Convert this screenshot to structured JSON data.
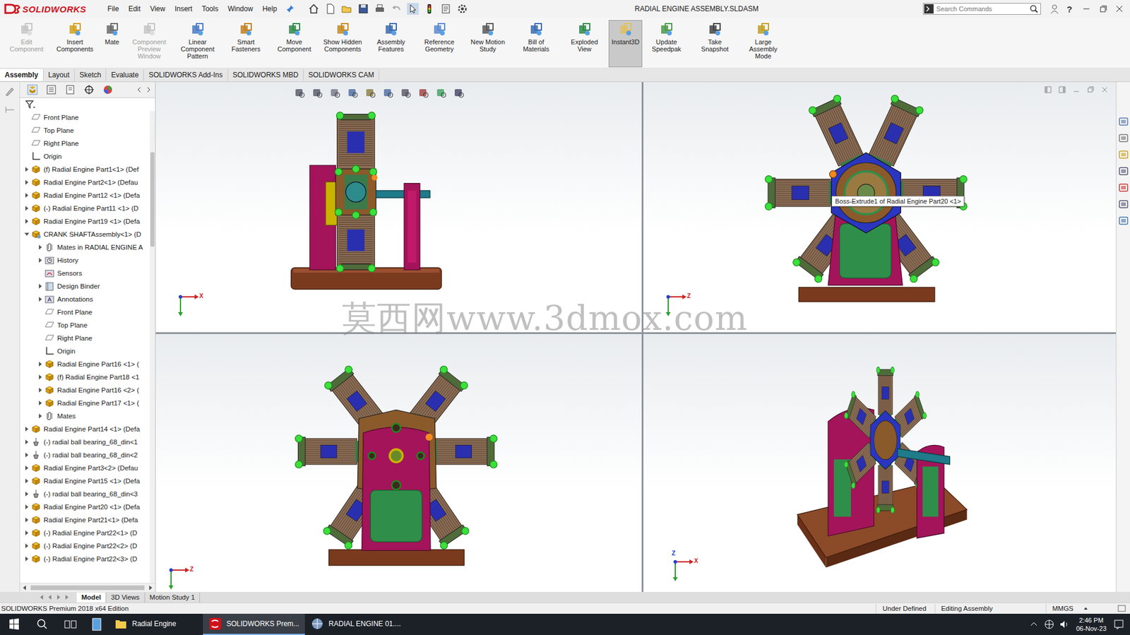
{
  "app": {
    "logo": "SOLIDWORKS"
  },
  "menu": [
    "File",
    "Edit",
    "View",
    "Insert",
    "Tools",
    "Window",
    "Help"
  ],
  "window": {
    "title": "RADIAL ENGINE ASSEMBLY.SLDASM"
  },
  "search": {
    "placeholder": "Search Commands"
  },
  "help": "?",
  "ribbon": [
    {
      "label": "Edit Component",
      "disabled": true,
      "selected": false
    },
    {
      "label": "Insert Components",
      "disabled": false,
      "selected": false
    },
    {
      "label": "Mate",
      "disabled": false,
      "selected": false
    },
    {
      "label": "Component Preview Window",
      "disabled": true,
      "selected": false
    },
    {
      "label": "Linear Component Pattern",
      "disabled": false,
      "selected": false
    },
    {
      "label": "Smart Fasteners",
      "disabled": false,
      "selected": false
    },
    {
      "label": "Move Component",
      "disabled": false,
      "selected": false
    },
    {
      "label": "Show Hidden Components",
      "disabled": false,
      "selected": false
    },
    {
      "label": "Assembly Features",
      "disabled": false,
      "selected": false
    },
    {
      "label": "Reference Geometry",
      "disabled": false,
      "selected": false
    },
    {
      "label": "New Motion Study",
      "disabled": false,
      "selected": false
    },
    {
      "label": "Bill of Materials",
      "disabled": false,
      "selected": false
    },
    {
      "label": "Exploded View",
      "disabled": false,
      "selected": false
    },
    {
      "label": "Instant3D",
      "disabled": false,
      "selected": true
    },
    {
      "label": "Update Speedpak",
      "disabled": false,
      "selected": false
    },
    {
      "label": "Take Snapshot",
      "disabled": false,
      "selected": false
    },
    {
      "label": "Large Assembly Mode",
      "disabled": false,
      "selected": false
    }
  ],
  "command_tabs": [
    {
      "label": "Assembly",
      "selected": true
    },
    {
      "label": "Layout",
      "selected": false
    },
    {
      "label": "Sketch",
      "selected": false
    },
    {
      "label": "Evaluate",
      "selected": false
    },
    {
      "label": "SOLIDWORKS Add-Ins",
      "selected": false
    },
    {
      "label": "SOLIDWORKS MBD",
      "selected": false
    },
    {
      "label": "SOLIDWORKS CAM",
      "selected": false
    }
  ],
  "tree": [
    {
      "label": "Front Plane",
      "indent": 0,
      "kind": "plane",
      "expandable": false,
      "expanded": false
    },
    {
      "label": "Top Plane",
      "indent": 0,
      "kind": "plane",
      "expandable": false,
      "expanded": false
    },
    {
      "label": "Right Plane",
      "indent": 0,
      "kind": "plane",
      "expandable": false,
      "expanded": false
    },
    {
      "label": "Origin",
      "indent": 0,
      "kind": "origin",
      "expandable": false,
      "expanded": false
    },
    {
      "label": "(f) Radial Engine Part1<1> (Def",
      "indent": 0,
      "kind": "part",
      "expandable": true,
      "expanded": false
    },
    {
      "label": "Radial Engine Part2<1> (Defau",
      "indent": 0,
      "kind": "part",
      "expandable": true,
      "expanded": false
    },
    {
      "label": "Radial Engine Part12 <1> (Defa",
      "indent": 0,
      "kind": "part",
      "expandable": true,
      "expanded": false
    },
    {
      "label": "(-) Radial Engine Part11 <1> (D",
      "indent": 0,
      "kind": "part",
      "expandable": true,
      "expanded": false
    },
    {
      "label": "Radial Engine Part19 <1> (Defa",
      "indent": 0,
      "kind": "part",
      "expandable": true,
      "expanded": false
    },
    {
      "label": "CRANK SHAFTAssembly<1> (D",
      "indent": 0,
      "kind": "assembly",
      "expandable": true,
      "expanded": true
    },
    {
      "label": "Mates in RADIAL ENGINE A",
      "indent": 1,
      "kind": "mates",
      "expandable": true,
      "expanded": false
    },
    {
      "label": "History",
      "indent": 1,
      "kind": "history",
      "expandable": true,
      "expanded": false
    },
    {
      "label": "Sensors",
      "indent": 1,
      "kind": "sensors",
      "expandable": false,
      "expanded": false
    },
    {
      "label": "Design Binder",
      "indent": 1,
      "kind": "binder",
      "expandable": true,
      "expanded": false
    },
    {
      "label": "Annotations",
      "indent": 1,
      "kind": "annotations",
      "expandable": true,
      "expanded": false
    },
    {
      "label": "Front Plane",
      "indent": 1,
      "kind": "plane",
      "expandable": false,
      "expanded": false
    },
    {
      "label": "Top Plane",
      "indent": 1,
      "kind": "plane",
      "expandable": false,
      "expanded": false
    },
    {
      "label": "Right Plane",
      "indent": 1,
      "kind": "plane",
      "expandable": false,
      "expanded": false
    },
    {
      "label": "Origin",
      "indent": 1,
      "kind": "origin",
      "expandable": false,
      "expanded": false
    },
    {
      "label": "Radial Engine Part16 <1> (",
      "indent": 1,
      "kind": "part",
      "expandable": true,
      "expanded": false
    },
    {
      "label": "(f) Radial Engine Part18 <1",
      "indent": 1,
      "kind": "part",
      "expandable": true,
      "expanded": false
    },
    {
      "label": "Radial Engine Part16 <2> (",
      "indent": 1,
      "kind": "part",
      "expandable": true,
      "expanded": false
    },
    {
      "label": "Radial Engine Part17 <1> (",
      "indent": 1,
      "kind": "part",
      "expandable": true,
      "expanded": false
    },
    {
      "label": "Mates",
      "indent": 1,
      "kind": "mates",
      "expandable": true,
      "expanded": false
    },
    {
      "label": "Radial Engine Part14 <1> (Defa",
      "indent": 0,
      "kind": "part",
      "expandable": true,
      "expanded": false
    },
    {
      "label": "(-) radial ball bearing_68_din<1",
      "indent": 0,
      "kind": "bearing",
      "expandable": true,
      "expanded": false
    },
    {
      "label": "(-) radial ball bearing_68_din<2",
      "indent": 0,
      "kind": "bearing",
      "expandable": true,
      "expanded": false
    },
    {
      "label": "Radial Engine Part3<2> (Defau",
      "indent": 0,
      "kind": "part",
      "expandable": true,
      "expanded": false
    },
    {
      "label": "Radial Engine Part15 <1> (Defa",
      "indent": 0,
      "kind": "part",
      "expandable": true,
      "expanded": false
    },
    {
      "label": "(-) radial ball bearing_68_din<3",
      "indent": 0,
      "kind": "bearing",
      "expandable": true,
      "expanded": false
    },
    {
      "label": "Radial Engine Part20 <1> (Defa",
      "indent": 0,
      "kind": "part",
      "expandable": true,
      "expanded": false
    },
    {
      "label": "Radial Engine Part21<1> (Defa",
      "indent": 0,
      "kind": "part",
      "expandable": true,
      "expanded": false
    },
    {
      "label": "(-) Radial Engine Part22<1> (D",
      "indent": 0,
      "kind": "part",
      "expandable": true,
      "expanded": false
    },
    {
      "label": "(-) Radial Engine Part22<2> (D",
      "indent": 0,
      "kind": "part",
      "expandable": true,
      "expanded": false
    },
    {
      "label": "(-) Radial Engine Part22<3> (D",
      "indent": 0,
      "kind": "part",
      "expandable": true,
      "expanded": false
    }
  ],
  "viewports": [
    {
      "axes": [
        "X"
      ]
    },
    {
      "axes": [
        "Z"
      ]
    },
    {
      "axes": [
        "Z"
      ]
    },
    {
      "axes": [
        "Z",
        "X"
      ]
    }
  ],
  "tooltip": "Boss-Extrude1 of Radial Engine Part20 <1>",
  "watermark": "莫西网www.3dmox.com",
  "model_tabs": [
    {
      "label": "Model",
      "selected": true
    },
    {
      "label": "3D Views",
      "selected": false
    },
    {
      "label": "Motion Study 1",
      "selected": false
    }
  ],
  "status_bar": {
    "edition": "SOLIDWORKS Premium 2018 x64 Edition",
    "state": "Under Defined",
    "mode": "Editing Assembly",
    "units": "MMGS"
  },
  "taskbar": {
    "items": [
      {
        "label": "Radial Engine",
        "selected": false
      },
      {
        "label": "SOLIDWORKS Prem...",
        "selected": true
      },
      {
        "label": "RADIAL ENGINE 01....",
        "selected": false
      }
    ],
    "time": "2:46 PM",
    "date": "06-Nov-23"
  }
}
